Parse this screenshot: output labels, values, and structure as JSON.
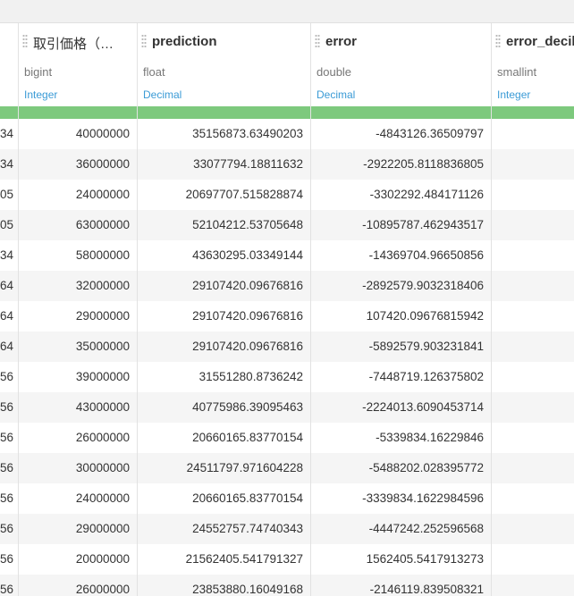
{
  "columns": [
    {
      "name": "",
      "sql_type": "",
      "data_type": ""
    },
    {
      "name": "取引価格（…",
      "sql_type": "bigint",
      "data_type": "Integer"
    },
    {
      "name": "prediction",
      "sql_type": "float",
      "data_type": "Decimal"
    },
    {
      "name": "error",
      "sql_type": "double",
      "data_type": "Decimal"
    },
    {
      "name": "error_decil",
      "sql_type": "smallint",
      "data_type": "Integer"
    }
  ],
  "rows": [
    [
      "34",
      "40000000",
      "35156873.63490203",
      "-4843126.36509797",
      ""
    ],
    [
      "34",
      "36000000",
      "33077794.18811632",
      "-2922205.8118836805",
      ""
    ],
    [
      "05",
      "24000000",
      "20697707.515828874",
      "-3302292.484171126",
      ""
    ],
    [
      "05",
      "63000000",
      "52104212.53705648",
      "-10895787.462943517",
      ""
    ],
    [
      "34",
      "58000000",
      "43630295.03349144",
      "-14369704.96650856",
      ""
    ],
    [
      "64",
      "32000000",
      "29107420.09676816",
      "-2892579.9032318406",
      ""
    ],
    [
      "64",
      "29000000",
      "29107420.09676816",
      "107420.09676815942",
      ""
    ],
    [
      "64",
      "35000000",
      "29107420.09676816",
      "-5892579.903231841",
      ""
    ],
    [
      "56",
      "39000000",
      "31551280.8736242",
      "-7448719.126375802",
      ""
    ],
    [
      "56",
      "43000000",
      "40775986.39095463",
      "-2224013.6090453714",
      ""
    ],
    [
      "56",
      "26000000",
      "20660165.83770154",
      "-5339834.16229846",
      ""
    ],
    [
      "56",
      "30000000",
      "24511797.971604228",
      "-5488202.028395772",
      ""
    ],
    [
      "56",
      "24000000",
      "20660165.83770154",
      "-3339834.1622984596",
      ""
    ],
    [
      "56",
      "29000000",
      "24552757.74740343",
      "-4447242.252596568",
      ""
    ],
    [
      "56",
      "20000000",
      "21562405.541791327",
      "1562405.5417913273",
      ""
    ],
    [
      "56",
      "26000000",
      "23853880.16049168",
      "-2146119.839508321",
      ""
    ]
  ],
  "colors": {
    "bar": "#7dc97d",
    "data_type": "#3b9bd6",
    "row_alt": "#f5f5f5"
  }
}
